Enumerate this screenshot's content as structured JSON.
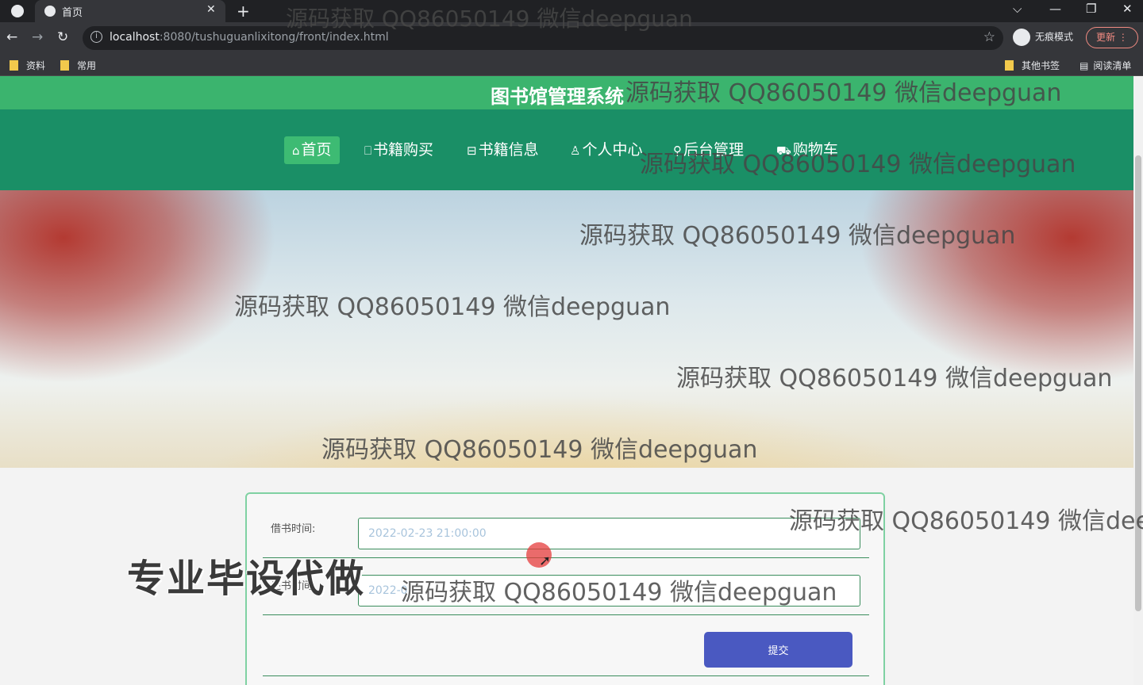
{
  "browser": {
    "tab_title": "首页",
    "url_host": "localhost",
    "url_rest": ":8080/tushuguanlixitong/front/index.html",
    "incognito_label": "无痕模式",
    "update_label": "更新",
    "bookmarks_left": [
      "资料",
      "常用"
    ],
    "bookmarks_right": [
      "其他书签",
      "阅读清单"
    ]
  },
  "site": {
    "title": "图书馆管理系统",
    "nav": [
      {
        "icon": "⌂",
        "label": "首页",
        "active": true
      },
      {
        "icon": "⎕",
        "label": "书籍购买"
      },
      {
        "icon": "⊟",
        "label": "书籍信息"
      },
      {
        "icon": "♙",
        "label": "个人中心"
      },
      {
        "icon": "⚲",
        "label": "后台管理"
      },
      {
        "icon": "⛟",
        "label": "购物车"
      }
    ]
  },
  "form": {
    "borrow_label": "借书时间:",
    "borrow_value": "2022-02-23 21:00:00",
    "return_label": "还书时间:",
    "return_value": "2022-0",
    "submit_label": "提交"
  },
  "overlay": {
    "watermark": "源码获取 QQ86050149 微信deepguan",
    "watermark_cut": "源码获取 QQ86050149 微信dee",
    "promo": "专业毕设代做"
  },
  "colors": {
    "header_green": "#3bb46e",
    "nav_green": "#1a8f66",
    "submit_blue": "#4a59c1"
  }
}
